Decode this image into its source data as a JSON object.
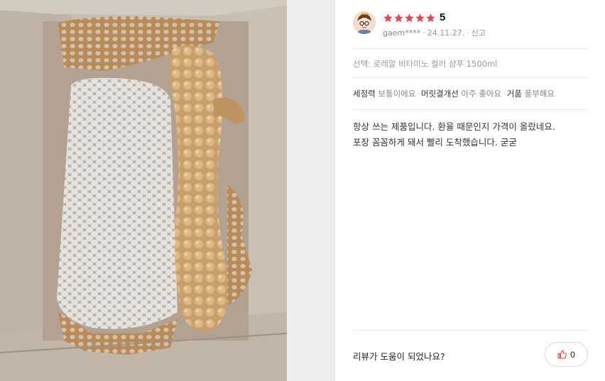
{
  "review": {
    "rating": "5",
    "star_count": 5,
    "star_color": "#f0424b",
    "username": "gaem****",
    "date": "24.11.27.",
    "report_label": "신고",
    "option": "선택: 로레알 비타미노 컬러 샴푸 1500ml",
    "attributes": [
      {
        "key": "세정력",
        "value": "보통이에요"
      },
      {
        "key": "머릿결개선",
        "value": "아주 좋아요"
      },
      {
        "key": "거품",
        "value": "풍부해요"
      }
    ],
    "text_line1": "항상 쓰는 제품입니다. 환율 때문인지 가격이 올랐네요.",
    "text_line2": "포장 꼼꼼하게 돼서 빨리 도착했습니다. 굳굳"
  },
  "footer": {
    "helpful_question": "리뷰가 도움이 되었나요?",
    "like_count": "0",
    "like_icon": "thumbs-up-icon"
  },
  "photo": {
    "subject": "product-box-photo"
  }
}
